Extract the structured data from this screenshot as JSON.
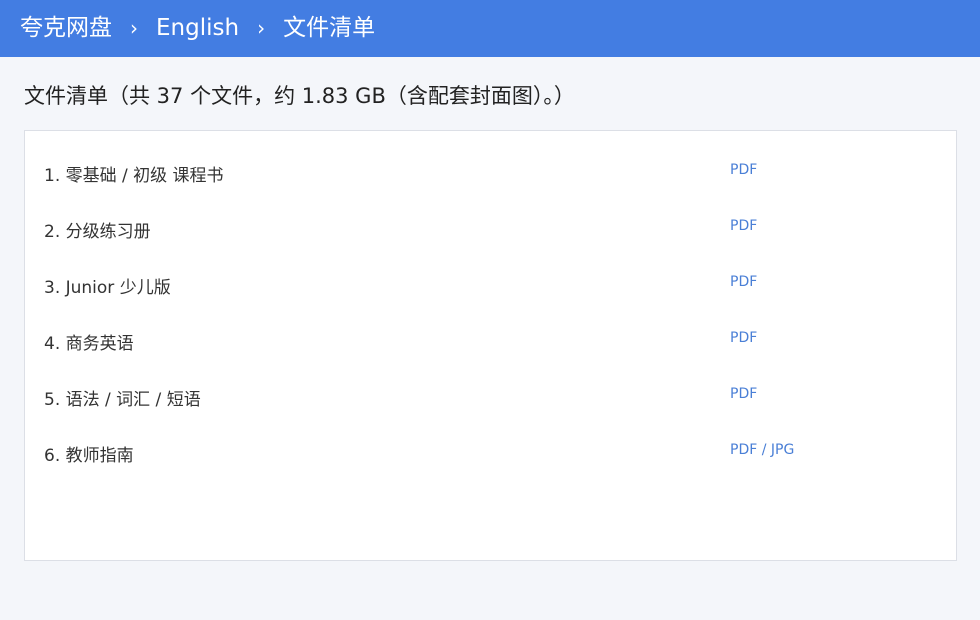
{
  "breadcrumb": [
    "夸克网盘",
    "English",
    "文件清单"
  ],
  "breadcrumb_separator": "›",
  "title": "文件清单（共 37 个文件，约 1.83 GB（含配套封面图）。）",
  "files": [
    {
      "name": "1. 零基础 / 初级 课程书",
      "type": "PDF"
    },
    {
      "name": "2. 分级练习册",
      "type": "PDF"
    },
    {
      "name": "3. Junior 少儿版",
      "type": "PDF"
    },
    {
      "name": "4. 商务英语",
      "type": "PDF"
    },
    {
      "name": "5. 语法 / 词汇 / 短语",
      "type": "PDF"
    },
    {
      "name": "6. 教师指南",
      "type": "PDF / JPG"
    }
  ],
  "colors": {
    "header": "#437de2",
    "link": "#4a7fd6",
    "background": "#f4f6fa"
  }
}
